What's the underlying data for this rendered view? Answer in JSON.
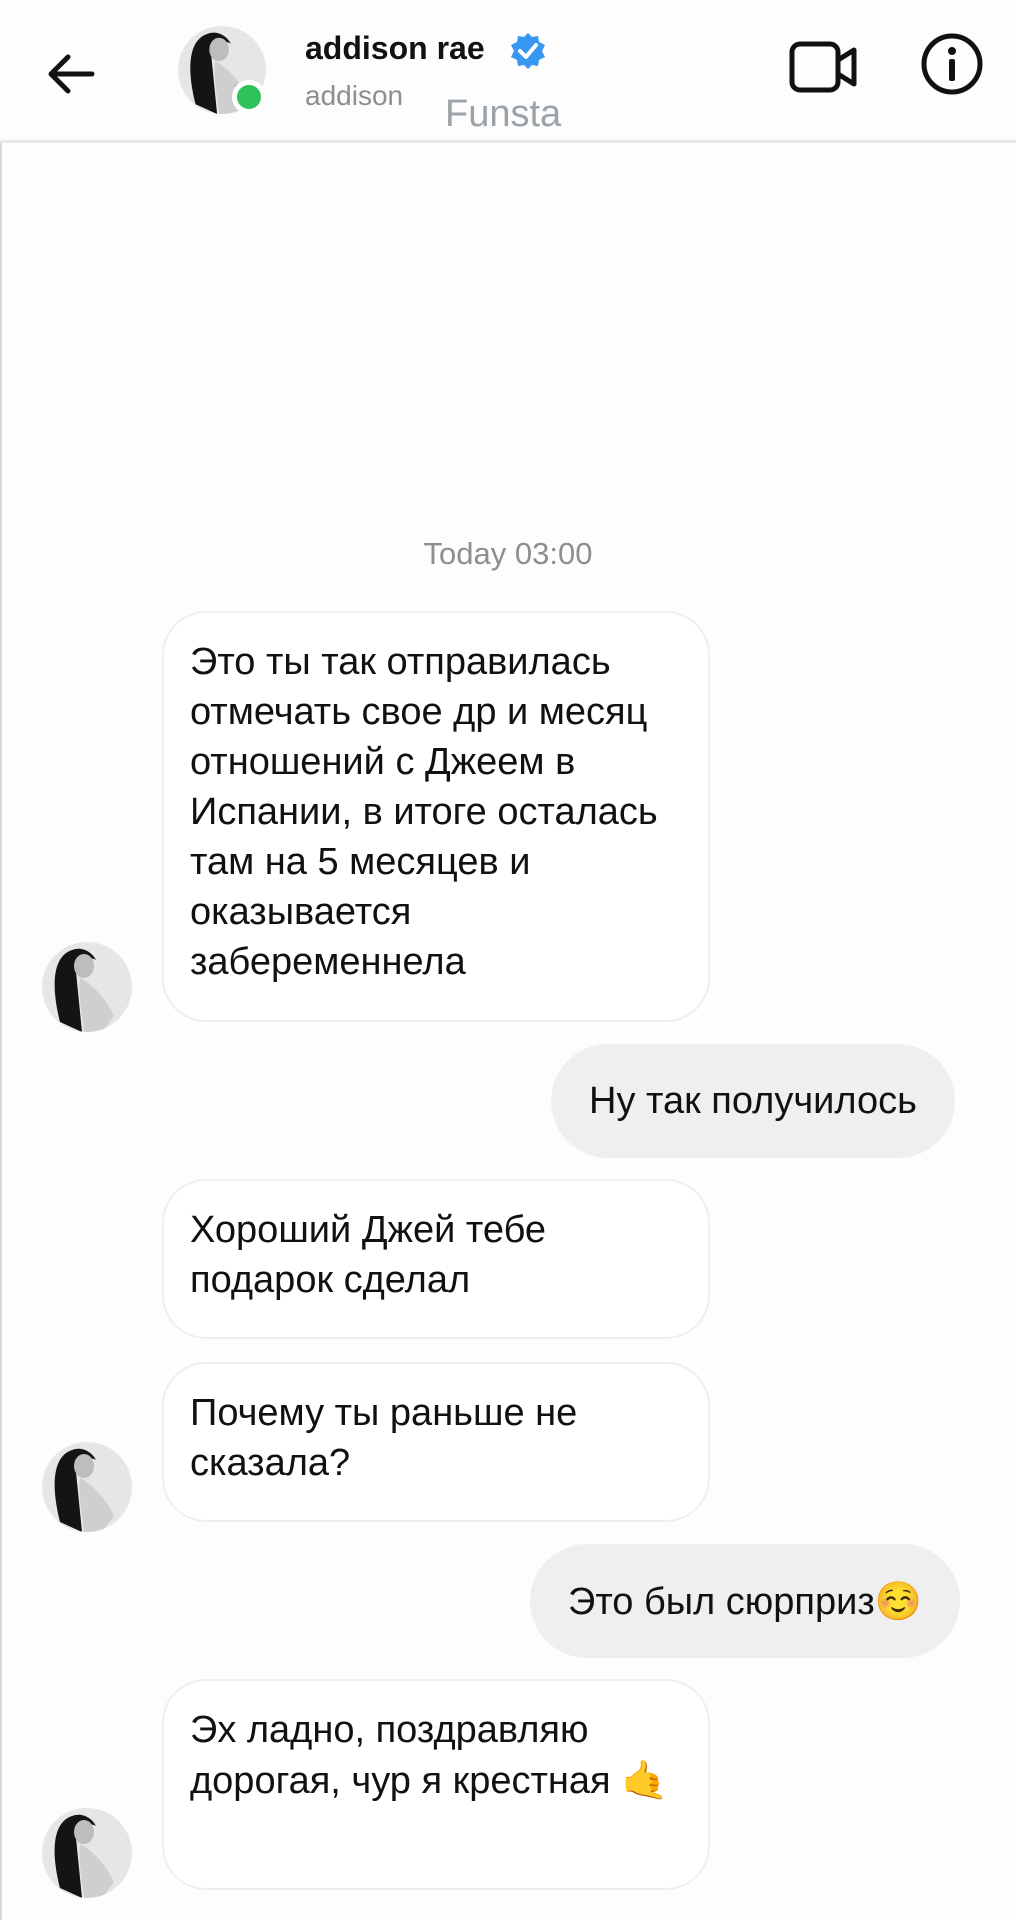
{
  "header": {
    "display_name": "addison rae",
    "username": "addison",
    "label_overlay": "Funsta",
    "icons": {
      "back": "arrow-left-icon",
      "verified": "verified-badge-icon",
      "video": "video-camera-icon",
      "info": "info-icon"
    },
    "online_color": "#2fc15a",
    "verified_color": "#3897f0"
  },
  "thread": {
    "timestamp": "Today 03:00",
    "messages": [
      {
        "from": "them",
        "text": "Это ты так отправилась отмечать свое др и месяц отношений с Джеем в Испании, в итоге осталась там на 5 месяцев и оказывается забеременнела"
      },
      {
        "from": "me",
        "text": "Ну так получилось"
      },
      {
        "from": "them",
        "text": "Хороший Джей тебе подарок сделал"
      },
      {
        "from": "them",
        "text": "Почему ты раньше не сказала?"
      },
      {
        "from": "me",
        "text": "Это был сюрприз",
        "emoji": "☺️"
      },
      {
        "from": "them",
        "text": "Эх ладно, поздравляю дорогая, чур я крестная",
        "emoji": "🤙"
      }
    ]
  },
  "colors": {
    "incoming_bubble": "#ffffff",
    "outgoing_bubble": "#efeff1",
    "muted_text": "#8e8e8e"
  }
}
